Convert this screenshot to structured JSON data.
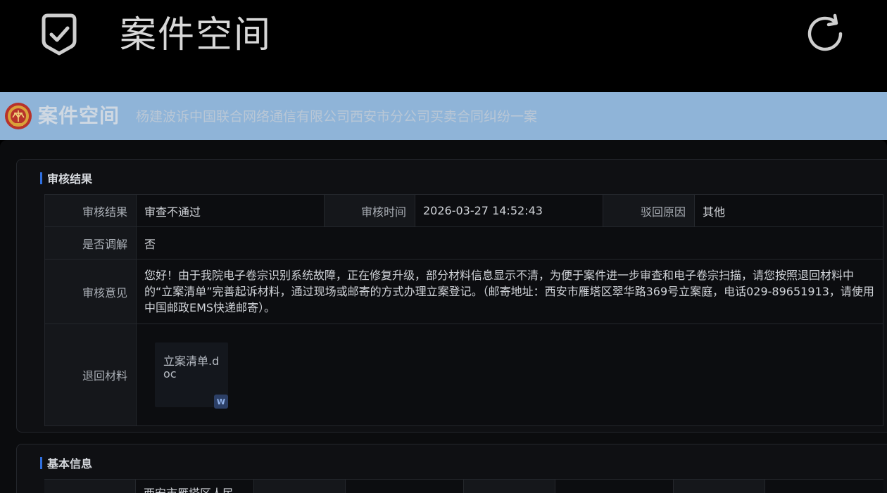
{
  "app": {
    "title": "案件空间"
  },
  "site": {
    "title": "案件空间",
    "case_name": "杨建波诉中国联合网络通信有限公司西安市分公司买卖合同纠纷一案"
  },
  "review": {
    "section_title": "审核结果",
    "result_label": "审核结果",
    "result_value": "审查不通过",
    "time_label": "审核时间",
    "time_value": "2026-03-27 14:52:43",
    "reject_reason_label": "驳回原因",
    "reject_reason_value": "其他",
    "mediation_label": "是否调解",
    "mediation_value": "否",
    "opinion_label": "审核意见",
    "opinion_value": "您好！由于我院电子卷宗识别系统故障，正在修复升级，部分材料信息显示不清，为便于案件进一步审查和电子卷宗扫描，请您按照退回材料中的“立案清单”完善起诉材料，通过现场或邮寄的方式办理立案登记。（邮寄地址：西安市雁塔区翠华路369号立案庭，电话029-89651913，请使用中国邮政EMS快递邮寄）。",
    "materials_label": "退回材料",
    "file_name": "立案清单.doc",
    "file_icon": "W"
  },
  "basic": {
    "section_title": "基本信息",
    "first_value_partial": "西安市雁塔区人民"
  },
  "colors": {
    "accent": "#2f6fdf",
    "header_bg": "#8fb4d8"
  },
  "icons": {
    "app": "shield-check-icon",
    "refresh": "refresh-icon",
    "court": "court-emblem-icon",
    "file": "word-file-icon"
  }
}
